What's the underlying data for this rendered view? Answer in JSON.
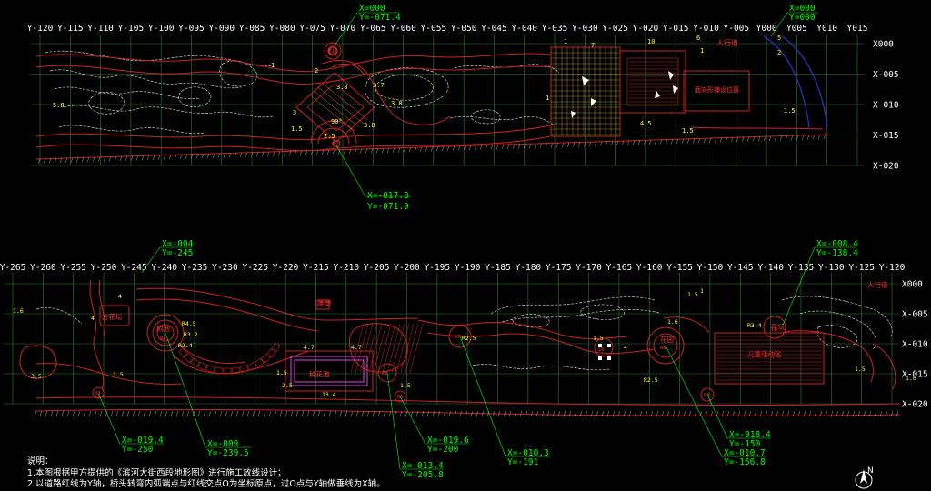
{
  "top_plan": {
    "y_labels": [
      "Y-120",
      "Y-115",
      "Y-110",
      "Y-105",
      "Y-100",
      "Y-095",
      "Y-090",
      "Y-085",
      "Y-080",
      "Y-075",
      "Y-070",
      "Y-065",
      "Y-060",
      "Y-055",
      "Y-050",
      "Y-045",
      "Y-040",
      "Y-035",
      "Y-030",
      "Y-025",
      "Y-020",
      "Y-015",
      "Y-010",
      "Y-005",
      "Y000",
      "Y005",
      "Y010",
      "Y015"
    ],
    "x_labels": [
      "X000",
      "X-005",
      "X-010",
      "X-015",
      "X-020"
    ],
    "tags": {
      "walkway": "人行道",
      "paving_note": "面向形铺设位置"
    },
    "dims": [
      "10",
      "6",
      "5",
      "2",
      "1",
      "7",
      "4.5",
      "5.8",
      "1",
      "2",
      "3",
      "3.8",
      "3.8",
      "3.7",
      "2.5",
      "90°",
      "1.5",
      "3.8",
      "1",
      "1.5",
      "1.5",
      "1"
    ],
    "callouts": [
      {
        "x": "X=000",
        "y": "Y=-071.4"
      },
      {
        "x": "X=000",
        "y": "Y=000"
      },
      {
        "x": "X=-017.3",
        "y": "Y=-071.9"
      }
    ],
    "markers": [
      "01",
      "02"
    ]
  },
  "bottom_plan": {
    "y_labels": [
      "Y-265",
      "Y-260",
      "Y-255",
      "Y-250",
      "Y-245",
      "Y-240",
      "Y-235",
      "Y-230",
      "Y-225",
      "Y-220",
      "Y-215",
      "Y-210",
      "Y-205",
      "Y-200",
      "Y-195",
      "Y-190",
      "Y-185",
      "Y-180",
      "Y-175",
      "Y-170",
      "Y-165",
      "Y-160",
      "Y-155",
      "Y-150",
      "Y-145",
      "Y-140",
      "Y-135",
      "Y-130",
      "Y-125",
      "Y-120"
    ],
    "x_labels": [
      "X000",
      "X-005",
      "X-010",
      "X-015",
      "X-020"
    ],
    "tags": {
      "walkway": "人行道",
      "flower_box": "方花坛",
      "tree_pool": "树池",
      "sculpture": "雕塑",
      "planter": "种花池",
      "flower_field": "花田",
      "small_square": "儿童活动区",
      "round_bed": "花坛"
    },
    "dims": [
      "4",
      "4",
      "1.6",
      "3.5",
      "1.5",
      "R4.5",
      "R3.2",
      "R2.4",
      "4.7",
      "4.7",
      "13.4",
      "1.5",
      "2.5",
      "1.6",
      "R2.5",
      "1.5",
      "4",
      "R2.5",
      "R3.4",
      "1",
      "1.5",
      "1.6",
      "1.5",
      "1.5"
    ],
    "callouts": [
      {
        "x": "X=-004",
        "y": "Y=-245"
      },
      {
        "x": "X=-008.4",
        "y": "Y=-138.4"
      },
      {
        "x": "X=-019.4",
        "y": "Y=-250"
      },
      {
        "x": "X=-009",
        "y": "Y=-239.5"
      },
      {
        "x": "X=-019.6",
        "y": "Y=-200"
      },
      {
        "x": "X=-013.4",
        "y": "Y=-205.8"
      },
      {
        "x": "X=-010.3",
        "y": "Y=-191"
      },
      {
        "x": "X=-018.4",
        "y": "Y=-150"
      },
      {
        "x": "X=-010.7",
        "y": "Y=-156.8"
      }
    ],
    "markers": [
      "03",
      "04",
      "05",
      "06",
      "07",
      "08",
      "09",
      "10",
      "11"
    ]
  },
  "notes": {
    "title": "说明：",
    "line1": "1.本图根据甲方提供的《滨河大街西段地形图》进行施工放线设计；",
    "line2": "2.以道路红线为Y轴，桥头转弯内弧端点与红线交点O为坐标原点，过O点与Y轴做垂线为X轴。"
  },
  "north": {
    "label": "N",
    "icon": "north-arrow-icon"
  },
  "colors": {
    "background": "#000000",
    "grid": "#2f7d2f",
    "axis_text": "#ffffff",
    "red_line": "#cc2222",
    "callout": "#00ff00",
    "contour": "#c8c8c8",
    "dim_yellow": "#ffff33",
    "magenta": "#dd44dd",
    "road": "#2233aa"
  }
}
